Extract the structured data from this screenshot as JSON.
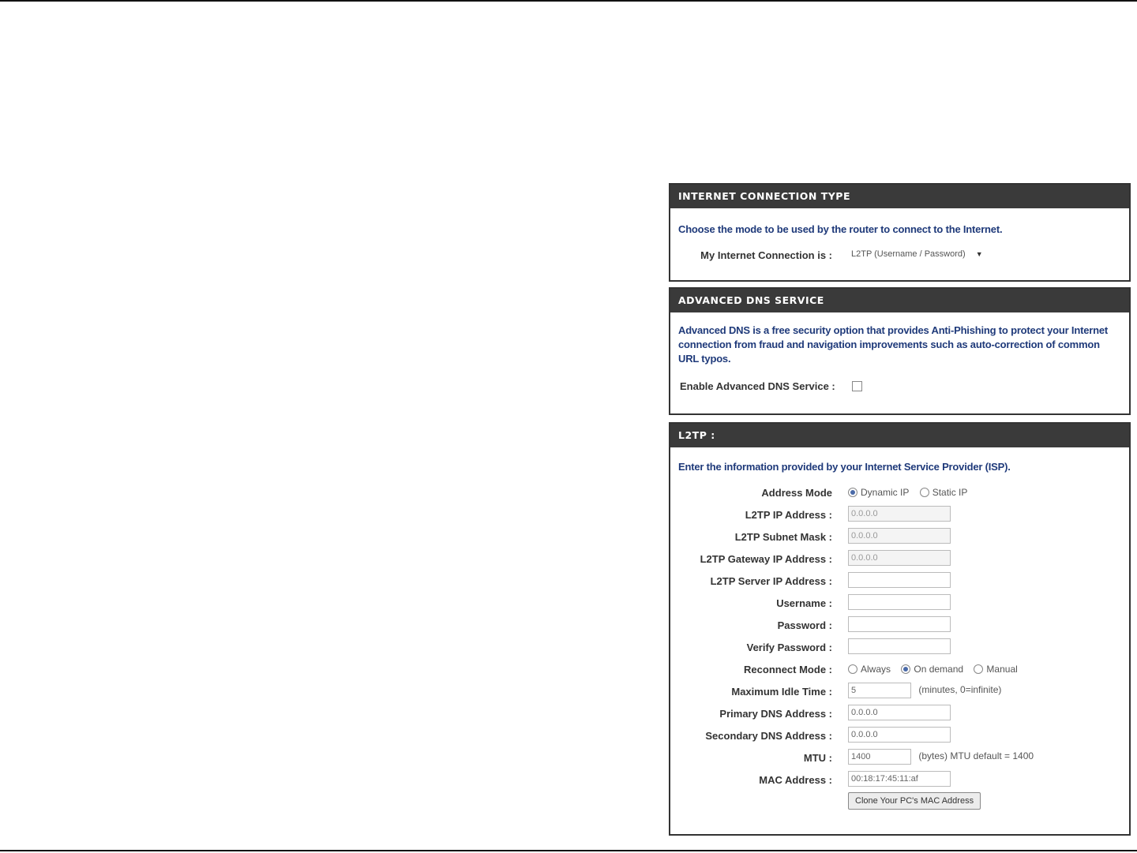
{
  "panels": {
    "ict": {
      "title": "INTERNET CONNECTION TYPE",
      "description": "Choose the mode to be used by the router to connect to the Internet.",
      "connection_label": "My Internet Connection is :",
      "connection_value": "L2TP (Username / Password)"
    },
    "dns": {
      "title": "ADVANCED DNS SERVICE",
      "description": "Advanced DNS is a free security option that provides Anti-Phishing to protect your Internet connection from fraud and navigation improvements such as auto-correction of common URL typos.",
      "enable_label": "Enable Advanced DNS Service :",
      "enabled": false
    },
    "l2tp": {
      "title": "L2TP :",
      "description": "Enter the information provided by your Internet Service Provider (ISP).",
      "address_mode": {
        "label": "Address Mode",
        "options": [
          "Dynamic IP",
          "Static IP"
        ],
        "selected": "Dynamic IP"
      },
      "ip_address": {
        "label": "L2TP IP Address :",
        "value": "0.0.0.0"
      },
      "subnet_mask": {
        "label": "L2TP Subnet Mask :",
        "value": "0.0.0.0"
      },
      "gateway": {
        "label": "L2TP Gateway IP Address :",
        "value": "0.0.0.0"
      },
      "server_ip": {
        "label": "L2TP Server IP Address :",
        "value": ""
      },
      "username": {
        "label": "Username :",
        "value": ""
      },
      "password": {
        "label": "Password :",
        "value": ""
      },
      "verify_password": {
        "label": "Verify Password :",
        "value": ""
      },
      "reconnect_mode": {
        "label": "Reconnect Mode :",
        "options": [
          "Always",
          "On demand",
          "Manual"
        ],
        "selected": "On demand"
      },
      "idle_time": {
        "label": "Maximum Idle Time :",
        "value": "5",
        "hint": "(minutes, 0=infinite)"
      },
      "primary_dns": {
        "label": "Primary DNS Address :",
        "value": "0.0.0.0"
      },
      "secondary_dns": {
        "label": "Secondary DNS Address :",
        "value": "0.0.0.0"
      },
      "mtu": {
        "label": "MTU :",
        "value": "1400",
        "hint": "(bytes) MTU default = 1400"
      },
      "mac": {
        "label": "MAC Address :",
        "value": "00:18:17:45:11:af"
      },
      "clone_button": "Clone Your PC's MAC Address"
    }
  }
}
